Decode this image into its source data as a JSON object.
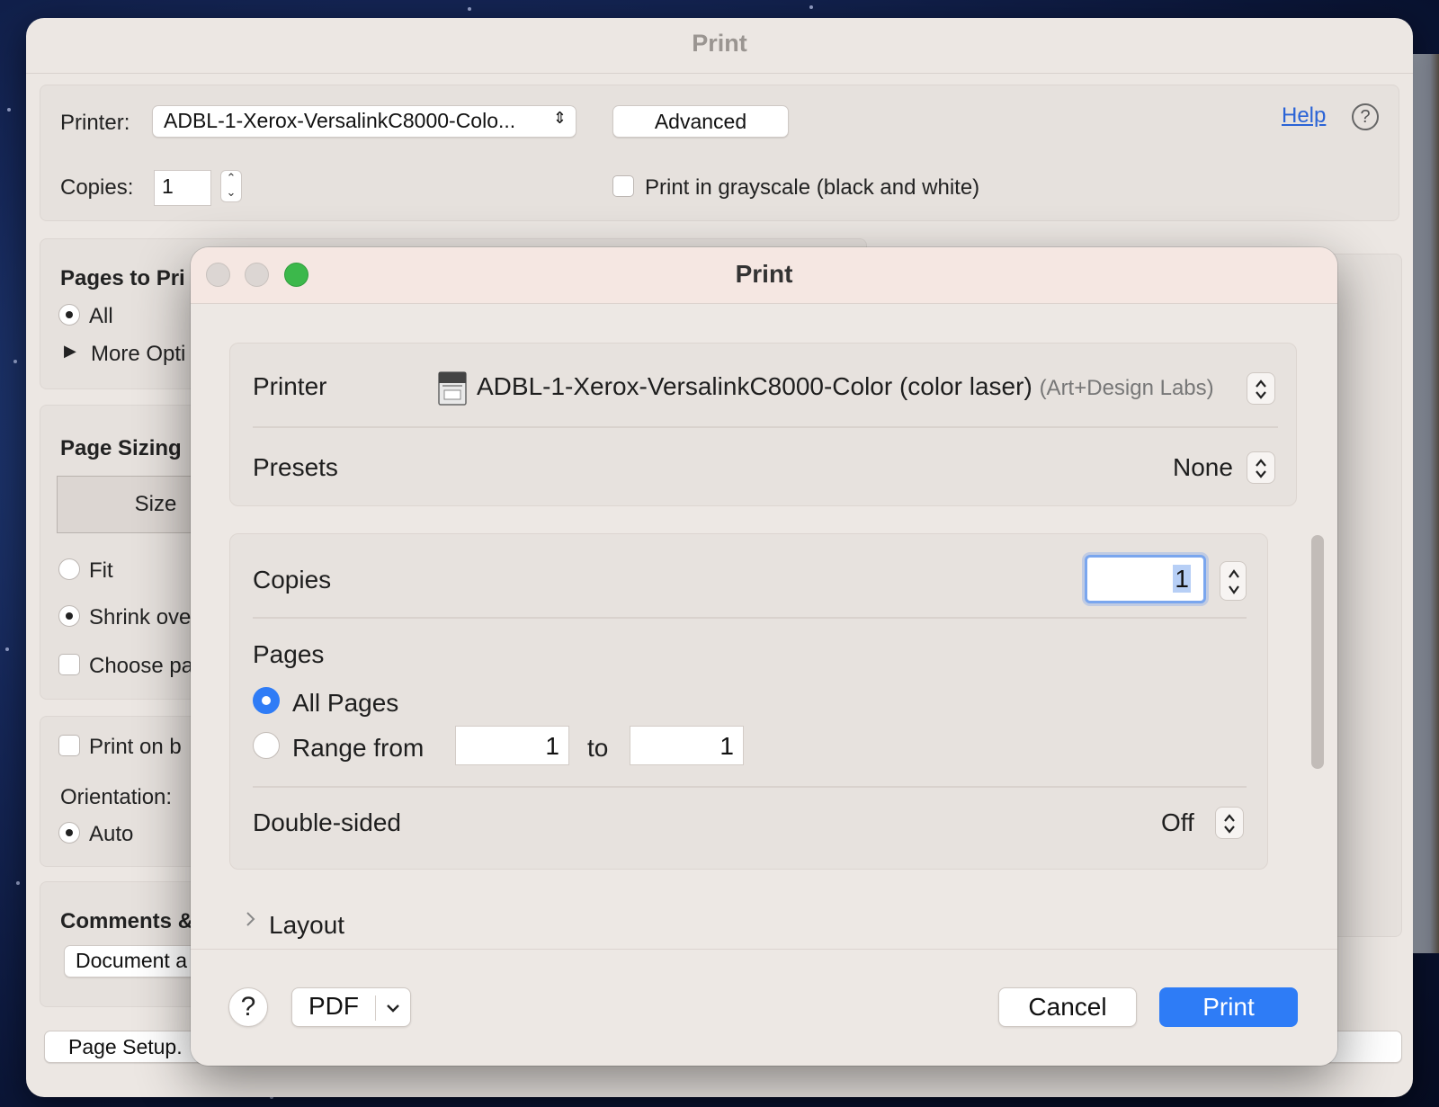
{
  "background_window": {
    "title": "Print",
    "printer_label": "Printer:",
    "printer_value": "ADBL-1-Xerox-VersalinkC8000-Colo...",
    "advanced_label": "Advanced",
    "help_link": "Help",
    "help_icon": "?",
    "copies_label": "Copies:",
    "copies_value": "1",
    "grayscale_label": "Print in grayscale (black and white)",
    "pages_to_print_title": "Pages to Pri",
    "all_label": "All",
    "more_options_label": "More Opti",
    "page_sizing_title": "Page Sizing",
    "size_label": "Size",
    "fit_label": "Fit",
    "shrink_label": "Shrink ove",
    "choose_label": "Choose pa",
    "print_on_label": "Print on b",
    "orientation_label": "Orientation:",
    "auto_label": "Auto",
    "comments_title": "Comments &",
    "document_label": "Document a",
    "page_setup_label": "Page Setup.",
    "next_arrow": ">"
  },
  "dialog": {
    "title": "Print",
    "printer_label": "Printer",
    "printer_name": "ADBL-1-Xerox-VersalinkC8000-Color (color laser)",
    "printer_location": "(Art+Design Labs)",
    "presets_label": "Presets",
    "presets_value": "None",
    "copies_label": "Copies",
    "copies_value": "1",
    "pages_label": "Pages",
    "all_pages_label": "All Pages",
    "range_from_label": "Range from",
    "range_from_value": "1",
    "range_to_label": "to",
    "range_to_value": "1",
    "double_sided_label": "Double-sided",
    "double_sided_value": "Off",
    "layout_label": "Layout",
    "help_button": "?",
    "pdf_label": "PDF",
    "cancel_label": "Cancel",
    "print_label": "Print"
  },
  "colors": {
    "accent": "#2e7cf6",
    "traffic_green": "#3cb84b",
    "link": "#2a63d6"
  }
}
